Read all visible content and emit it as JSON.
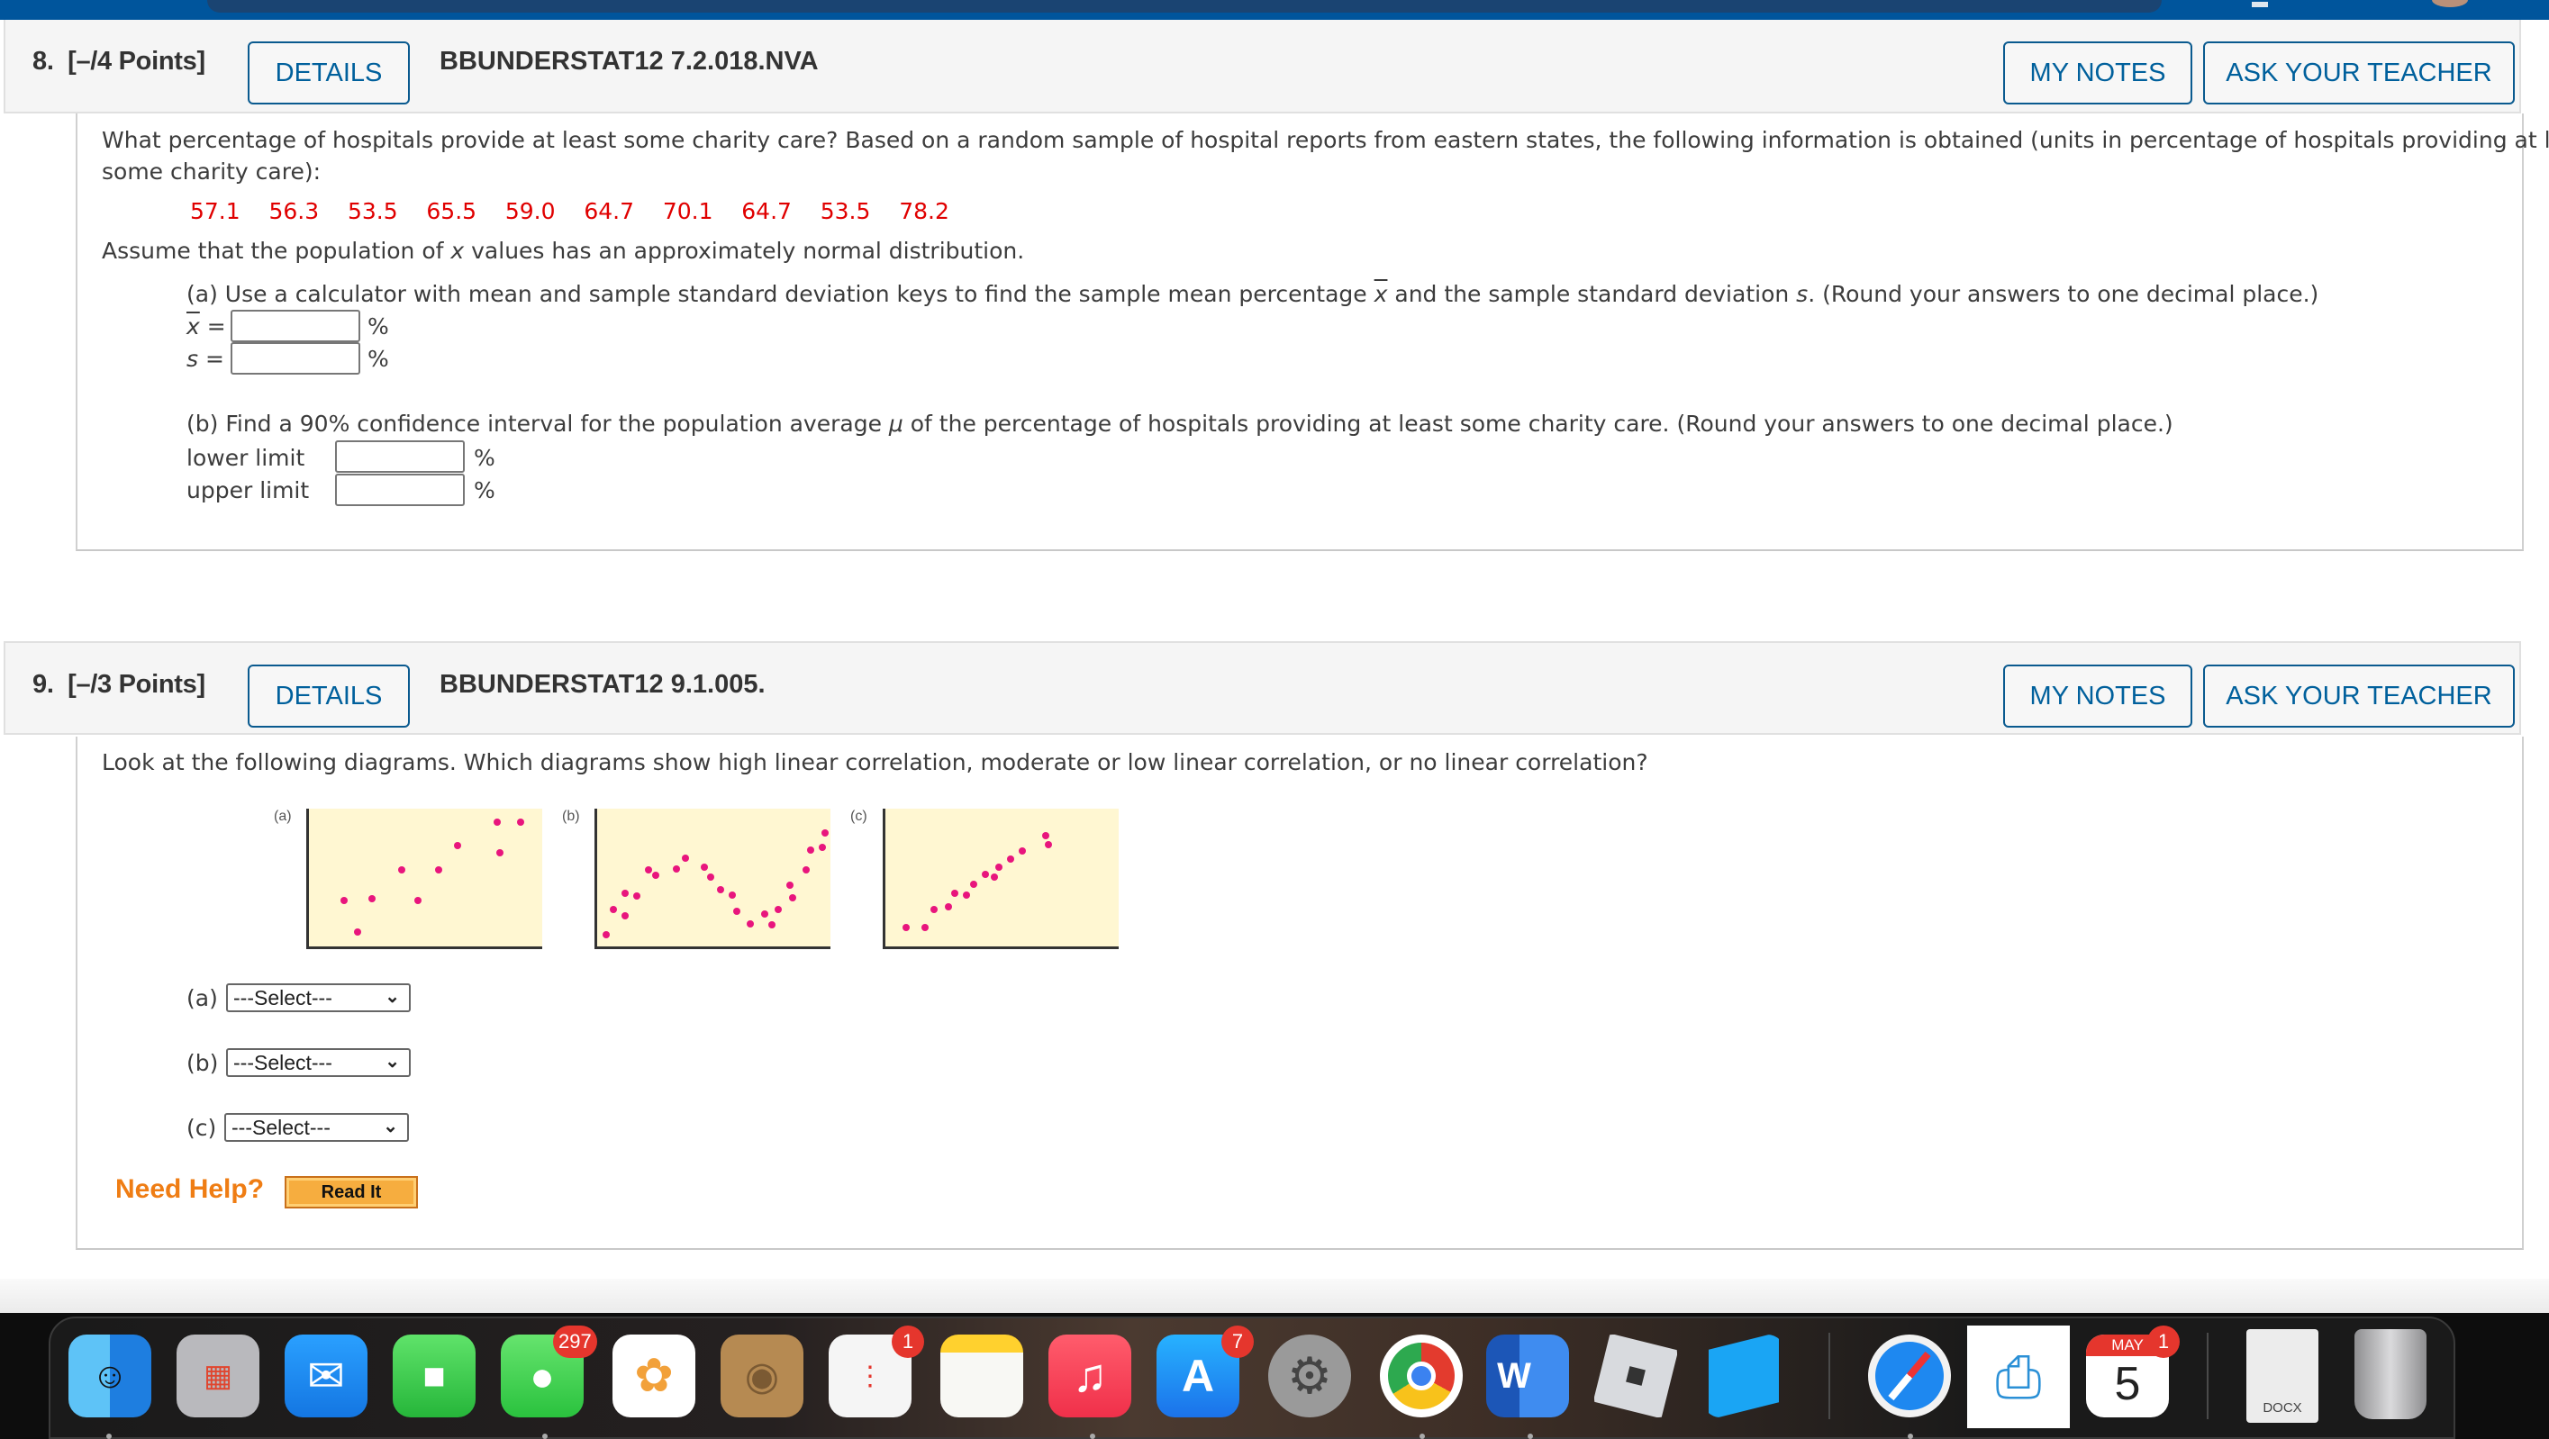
{
  "questions": [
    {
      "number": "8.",
      "points": "[–/4 Points]",
      "details_label": "DETAILS",
      "code": "BBUNDERSTAT12 7.2.018.NVA",
      "my_notes_label": "MY NOTES",
      "ask_teacher_label": "ASK YOUR TEACHER",
      "prompt_line1": "What percentage of hospitals provide at least some charity care? Based on a random sample of hospital reports from eastern states, the following information is obtained (units in percentage of hospitals providing at least",
      "prompt_line2": "some charity care):",
      "data_values": [
        "57.1",
        "56.3",
        "53.5",
        "65.5",
        "59.0",
        "64.7",
        "70.1",
        "64.7",
        "53.5",
        "78.2"
      ],
      "assumption_pre": "Assume that the population of ",
      "assumption_var": "x",
      "assumption_post": " values has an approximately normal distribution.",
      "part_a": {
        "text_pre": "(a) Use a calculator with mean and sample standard deviation keys to find the sample mean percentage ",
        "text_var1": "x",
        "text_mid": " and the sample standard deviation ",
        "text_var2": "s",
        "text_post": ". (Round your answers to one decimal place.)",
        "xbar_label": "x",
        "s_label": "s",
        "equals": "=",
        "xbar_value": "",
        "s_value": "",
        "unit": "%"
      },
      "part_b": {
        "text_pre": "(b) Find a 90% confidence interval for the population average ",
        "text_var": "μ",
        "text_post": " of the percentage of hospitals providing at least some charity care. (Round your answers to one decimal place.)",
        "lower_label": "lower limit",
        "upper_label": "upper limit",
        "lower_value": "",
        "upper_value": "",
        "unit": "%"
      }
    },
    {
      "number": "9.",
      "points": "[–/3 Points]",
      "details_label": "DETAILS",
      "code": "BBUNDERSTAT12 9.1.005.",
      "my_notes_label": "MY NOTES",
      "ask_teacher_label": "ASK YOUR TEACHER",
      "prompt": "Look at the following diagrams. Which diagrams show high linear correlation, moderate or low linear correlation, or no linear correlation?",
      "diagram_labels": [
        "(a)",
        "(b)",
        "(c)"
      ],
      "selects": [
        {
          "label": "(a)",
          "value": "---Select---"
        },
        {
          "label": "(b)",
          "value": "---Select---"
        },
        {
          "label": "(c)",
          "value": "---Select---"
        }
      ],
      "need_help": "Need Help?",
      "read_it": "Read It"
    }
  ],
  "scatter_diagrams": {
    "dot_color": "#e8157d",
    "background": "#fff7d2",
    "a": [
      [
        0.15,
        0.33
      ],
      [
        0.21,
        0.1
      ],
      [
        0.27,
        0.34
      ],
      [
        0.4,
        0.55
      ],
      [
        0.47,
        0.33
      ],
      [
        0.56,
        0.55
      ],
      [
        0.64,
        0.73
      ],
      [
        0.81,
        0.9
      ],
      [
        0.82,
        0.68
      ],
      [
        0.91,
        0.9
      ]
    ],
    "b": [
      [
        0.04,
        0.08
      ],
      [
        0.07,
        0.26
      ],
      [
        0.12,
        0.22
      ],
      [
        0.12,
        0.38
      ],
      [
        0.17,
        0.36
      ],
      [
        0.22,
        0.55
      ],
      [
        0.25,
        0.51
      ],
      [
        0.34,
        0.56
      ],
      [
        0.38,
        0.64
      ],
      [
        0.46,
        0.57
      ],
      [
        0.49,
        0.5
      ],
      [
        0.53,
        0.41
      ],
      [
        0.58,
        0.37
      ],
      [
        0.6,
        0.25
      ],
      [
        0.66,
        0.16
      ],
      [
        0.72,
        0.23
      ],
      [
        0.75,
        0.15
      ],
      [
        0.78,
        0.26
      ],
      [
        0.83,
        0.44
      ],
      [
        0.84,
        0.35
      ],
      [
        0.9,
        0.55
      ],
      [
        0.92,
        0.7
      ],
      [
        0.97,
        0.72
      ],
      [
        0.98,
        0.82
      ]
    ],
    "c": [
      [
        0.09,
        0.13
      ],
      [
        0.17,
        0.13
      ],
      [
        0.21,
        0.26
      ],
      [
        0.27,
        0.28
      ],
      [
        0.3,
        0.38
      ],
      [
        0.35,
        0.37
      ],
      [
        0.38,
        0.45
      ],
      [
        0.43,
        0.52
      ],
      [
        0.47,
        0.5
      ],
      [
        0.49,
        0.57
      ],
      [
        0.54,
        0.63
      ],
      [
        0.59,
        0.69
      ],
      [
        0.69,
        0.8
      ],
      [
        0.7,
        0.74
      ]
    ]
  },
  "dock": {
    "apps": [
      {
        "name": "finder"
      },
      {
        "name": "launchpad"
      },
      {
        "name": "mail"
      },
      {
        "name": "facetime"
      },
      {
        "name": "messages",
        "badge": "297"
      },
      {
        "name": "photos"
      },
      {
        "name": "contacts"
      },
      {
        "name": "reminders",
        "badge": "1"
      },
      {
        "name": "notes"
      },
      {
        "name": "music"
      },
      {
        "name": "app-store",
        "badge": "7"
      },
      {
        "name": "system-preferences"
      },
      {
        "name": "chrome"
      },
      {
        "name": "word"
      },
      {
        "name": "roblox-player"
      },
      {
        "name": "roblox-studio"
      },
      {
        "name": "safari"
      },
      {
        "name": "printer"
      },
      {
        "name": "calendar",
        "badge": "1",
        "month": "MAY",
        "day": "5"
      },
      {
        "name": "docx-file",
        "label": "DOCX"
      },
      {
        "name": "trash"
      }
    ]
  }
}
